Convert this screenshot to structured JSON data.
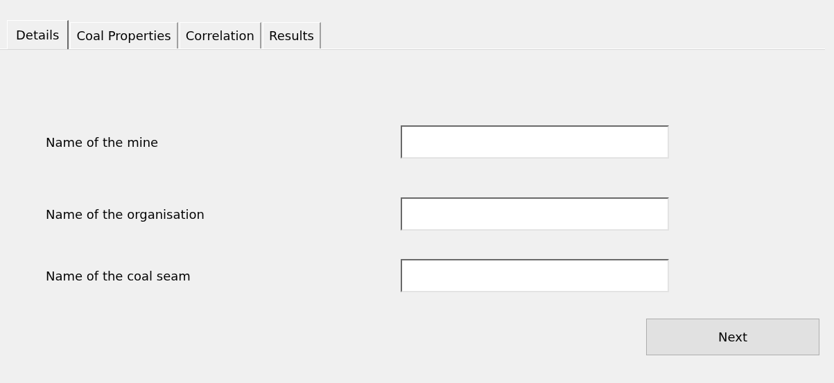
{
  "tabs": [
    {
      "label": "Details",
      "selected": true
    },
    {
      "label": "Coal Properties",
      "selected": false
    },
    {
      "label": "Correlation",
      "selected": false
    },
    {
      "label": "Results",
      "selected": false
    }
  ],
  "fields": [
    {
      "label": "Name of the mine"
    },
    {
      "label": "Name of the organisation"
    },
    {
      "label": "Name of the coal seam"
    }
  ],
  "buttons": [
    "Next"
  ]
}
